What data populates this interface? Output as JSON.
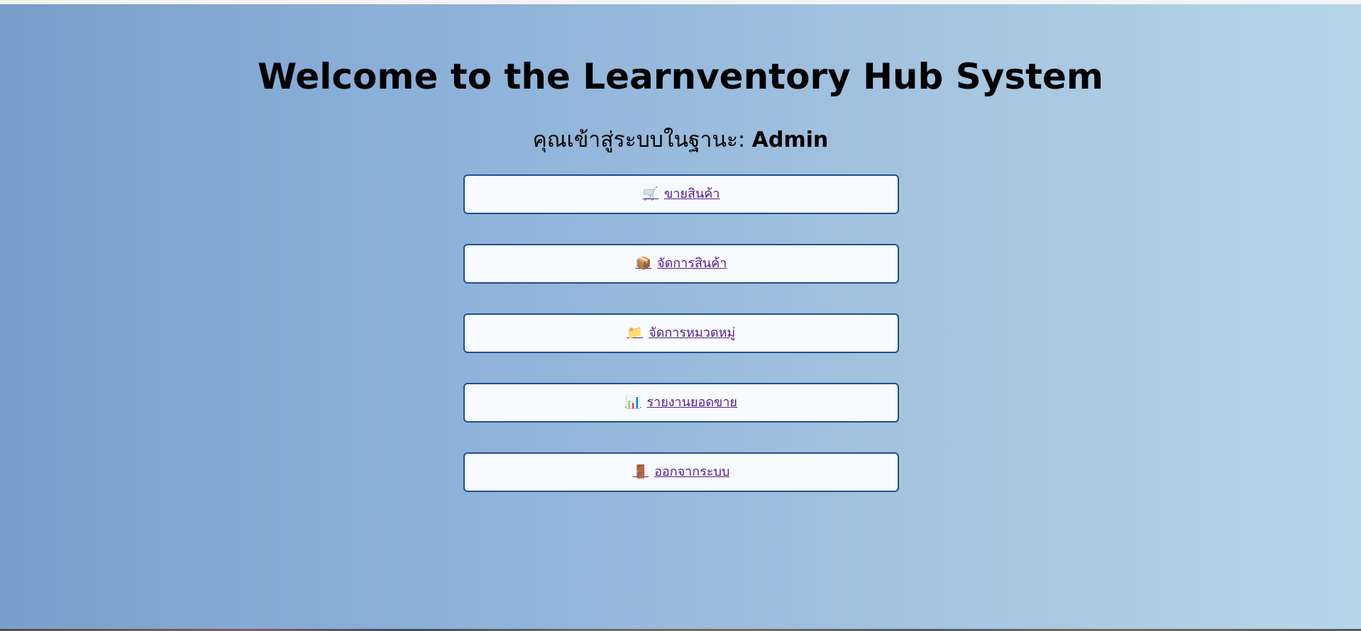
{
  "header": {
    "title": "Welcome to the Learnventory Hub System"
  },
  "role": {
    "prefix": "คุณเข้าสู่ระบบในฐานะ: ",
    "value": "Admin"
  },
  "menu": {
    "items": [
      {
        "label": "ขายสินค้า",
        "icon": "shopping-cart-icon",
        "glyph": "🛒"
      },
      {
        "label": "จัดการสินค้า",
        "icon": "package-icon",
        "glyph": "📦"
      },
      {
        "label": "จัดการหมวดหมู่",
        "icon": "folder-icon",
        "glyph": "📁"
      },
      {
        "label": "รายงานยอดขาย",
        "icon": "bar-chart-icon",
        "glyph": "📊"
      },
      {
        "label": "ออกจากระบบ",
        "icon": "door-icon",
        "glyph": "🚪"
      }
    ]
  },
  "colors": {
    "gradient_left": "#789fcc",
    "gradient_right": "#b6d6e8",
    "button_border": "#1f4f8c",
    "button_fill": "#f7fbff",
    "link": "#551a8b"
  }
}
